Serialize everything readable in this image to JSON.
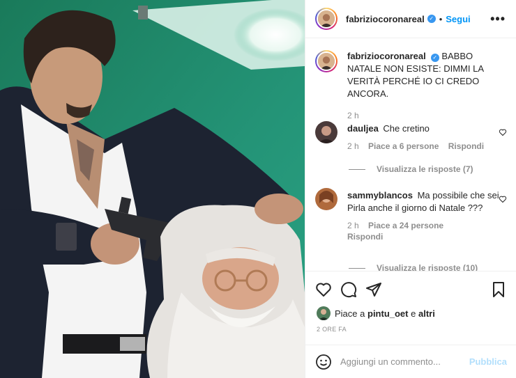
{
  "post": {
    "author": "fabriziocoronareal",
    "follow_label": "Segui",
    "separator": "•",
    "more_label": "•••"
  },
  "caption": {
    "author": "fabriziocoronareal",
    "text": "BABBO NATALE NON ESISTE: DIMMI LA VERITÀ PERCHÉ IO CI CREDO ANCORA.",
    "time": "2 h"
  },
  "comments": [
    {
      "author": "dauljea",
      "text": "Che cretino",
      "time": "2 h",
      "likes": "Piace a 6 persone",
      "reply_label": "Rispondi",
      "replies_label": "Visualizza le risposte (7)"
    },
    {
      "author": "sammyblancos",
      "text": "Ma possibile che sei Pirla anche il giorno di Natale ???",
      "time": "2 h",
      "likes": "Piace a 24 persone",
      "reply_label": "Rispondi",
      "replies_label": "Visualizza le risposte (10)"
    }
  ],
  "likes_line": {
    "prefix": "Piace a ",
    "user": "pintu_oet",
    "middle": " e ",
    "others": "altri"
  },
  "timestamp": "2 ORE FA",
  "comment_box": {
    "placeholder": "Aggiungi un commento...",
    "publish_label": "Pubblica"
  },
  "icons": {
    "like": "heart-icon",
    "comment": "comment-icon",
    "share": "send-icon",
    "save": "bookmark-icon",
    "emoji": "emoji-icon",
    "verified": "verified-badge-icon"
  },
  "colors": {
    "accent": "#0095f6",
    "publish_disabled": "#b2dffc",
    "verified": "#3897f0",
    "muted": "#8e8e8e"
  }
}
